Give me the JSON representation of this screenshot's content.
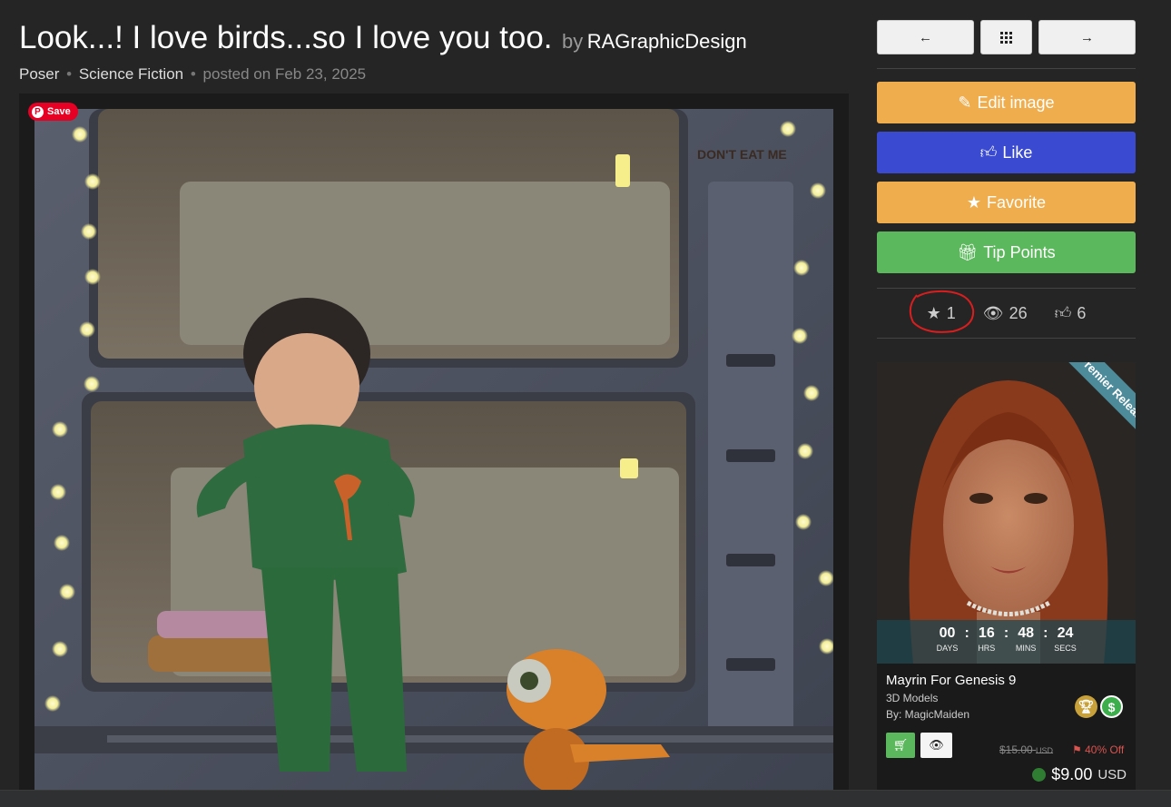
{
  "header": {
    "title": "Look...! I love birds...so I love you too.",
    "by": "by",
    "author": "RAGraphicDesign",
    "category1": "Poser",
    "category2": "Science Fiction",
    "posted": "posted on Feb 23, 2025",
    "sep": "•"
  },
  "image": {
    "pin_save_label": "Save",
    "pin_icon": "P",
    "wall_text": "DON'T EAT ME"
  },
  "nav": {
    "prev_icon": "arrow-left-icon",
    "grid_icon": "grid-icon",
    "next_icon": "arrow-right-icon"
  },
  "actions": {
    "edit": "Edit image",
    "like": "Like",
    "favorite": "Favorite",
    "tip": "Tip Points",
    "colors": {
      "edit": "#f0ad4e",
      "like": "#3b4bd1",
      "favorite": "#f0ad4e",
      "tip": "#5cb85c"
    }
  },
  "stats": {
    "favorites": "1",
    "views": "26",
    "likes": "6"
  },
  "ad": {
    "ribbon": "Premier Release",
    "countdown": [
      {
        "value": "00",
        "label": "DAYS"
      },
      {
        "value": "16",
        "label": "HRS"
      },
      {
        "value": "48",
        "label": "MINS"
      },
      {
        "value": "24",
        "label": "SECS"
      }
    ],
    "name": "Mayrin For Genesis 9",
    "category": "3D Models",
    "by": "By: MagicMaiden",
    "old_price": "$15.00",
    "old_currency": "USD",
    "discount": "40% Off",
    "new_price": "$9.00",
    "new_currency": "USD"
  }
}
